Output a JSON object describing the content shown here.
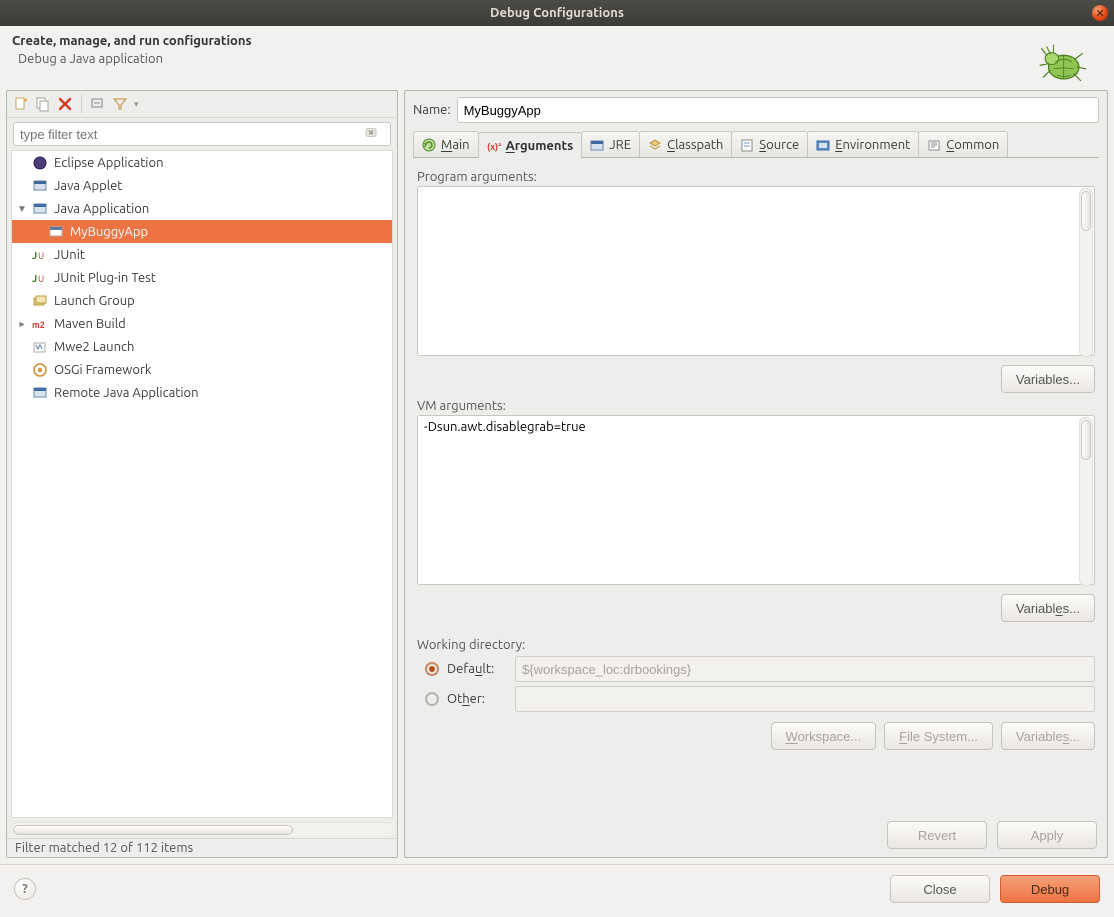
{
  "window": {
    "title": "Debug Configurations"
  },
  "header": {
    "title": "Create, manage, and run configurations",
    "subtitle": "Debug a Java application"
  },
  "left": {
    "filter_placeholder": "type filter text",
    "nodes": [
      {
        "label": "Eclipse Application",
        "exp": "",
        "depth": 0
      },
      {
        "label": "Java Applet",
        "exp": "",
        "depth": 0
      },
      {
        "label": "Java Application",
        "exp": "▼",
        "depth": 0
      },
      {
        "label": "MyBuggyApp",
        "exp": "",
        "depth": 1,
        "selected": true
      },
      {
        "label": "JUnit",
        "exp": "",
        "depth": 0
      },
      {
        "label": "JUnit Plug-in Test",
        "exp": "",
        "depth": 0
      },
      {
        "label": "Launch Group",
        "exp": "",
        "depth": 0
      },
      {
        "label": "Maven Build",
        "exp": "▸",
        "depth": 0
      },
      {
        "label": "Mwe2 Launch",
        "exp": "",
        "depth": 0
      },
      {
        "label": "OSGi Framework",
        "exp": "",
        "depth": 0
      },
      {
        "label": "Remote Java Application",
        "exp": "",
        "depth": 0
      }
    ],
    "status": "Filter matched 12 of 112 items"
  },
  "right": {
    "name_label": "Name:",
    "name_value": "MyBuggyApp",
    "tabs": [
      "Main",
      "Arguments",
      "JRE",
      "Classpath",
      "Source",
      "Environment",
      "Common"
    ],
    "active_tab": "Arguments",
    "argtab": {
      "prog_label": "Program arguments:",
      "prog_value": "",
      "vm_label": "VM arguments:",
      "vm_value": "-Dsun.awt.disablegrab=true",
      "variables_btn": "Variables...",
      "variables_btn2": "Variables...",
      "workdir_label": "Working directory:",
      "default_label": "Default:",
      "default_value": "${workspace_loc:drbookings}",
      "other_label": "Other:",
      "workspace_btn": "Workspace...",
      "filesystem_btn": "File System...",
      "variables_btn3": "Variables..."
    },
    "revert_btn": "Revert",
    "apply_btn": "Apply"
  },
  "bottom": {
    "close_btn": "Close",
    "debug_btn": "Debug"
  }
}
